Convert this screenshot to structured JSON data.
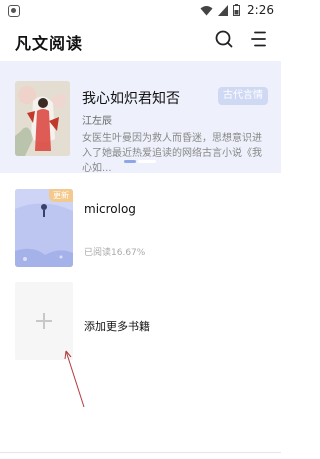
{
  "status_bar": {
    "time": "2:26"
  },
  "header": {
    "title": "凡文阅读"
  },
  "banner": {
    "book_title": "我心如炽君知否",
    "genre": "古代言情",
    "author": "江左辰",
    "summary": "女医生叶曼因为救人而昏迷，思想意识进入了她最近热爱追读的网络古言小说《我心如..."
  },
  "shelf": {
    "items": [
      {
        "name": "microlog",
        "progress": "已阅读16.67%",
        "badge": "更新"
      }
    ],
    "add_label": "添加更多书籍"
  },
  "colors": {
    "accent": "#8ea6e6",
    "banner_bg": "#eef1fb",
    "update_badge": "#f4c98d"
  }
}
